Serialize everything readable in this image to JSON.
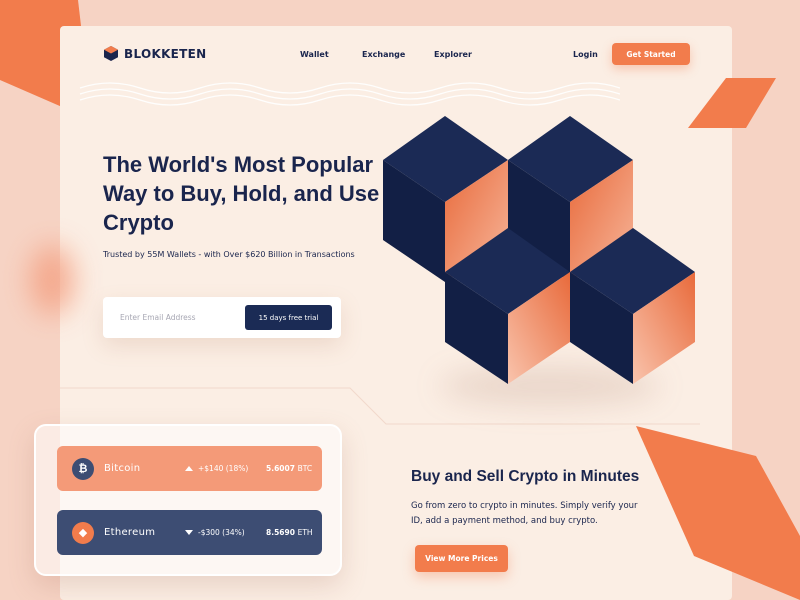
{
  "brand": {
    "name": "BLOKKETEN",
    "logo_icon": "hexagon-cube-icon"
  },
  "nav": {
    "links": [
      "Wallet",
      "Exchange",
      "Explorer"
    ],
    "login": "Login",
    "cta": "Get Started"
  },
  "hero": {
    "title_regular": "The World's Most Popular Way to Buy, Hold, and",
    "title_bold": "Use Crypto",
    "subtitle": "Trusted by 55M Wallets - with Over $620 Billion in Transactions",
    "email_placeholder": "Enter Email Address",
    "trial_button": "15 days free trial"
  },
  "coins": [
    {
      "name": "Bitcoin",
      "icon": "bitcoin-icon",
      "symbol_glyph": "₿",
      "change": "+$140 (18%)",
      "direction": "up",
      "amount": "5.6007",
      "unit": "BTC"
    },
    {
      "name": "Ethereum",
      "icon": "ethereum-icon",
      "symbol_glyph": "◆",
      "change": "-$300 (34%)",
      "direction": "down",
      "amount": "8.5690",
      "unit": "ETH"
    }
  ],
  "section": {
    "title": "Buy and Sell Crypto in Minutes",
    "body": "Go from zero to crypto in minutes. Simply verify your ID, add a payment method, and buy crypto.",
    "button": "View More Prices"
  },
  "colors": {
    "background": "#f6d3c4",
    "card": "#fbeee4",
    "accent": "#f27c4c",
    "navy": "#1a254d",
    "btc_row": "#f49a78",
    "eth_row": "#3d4d73"
  }
}
